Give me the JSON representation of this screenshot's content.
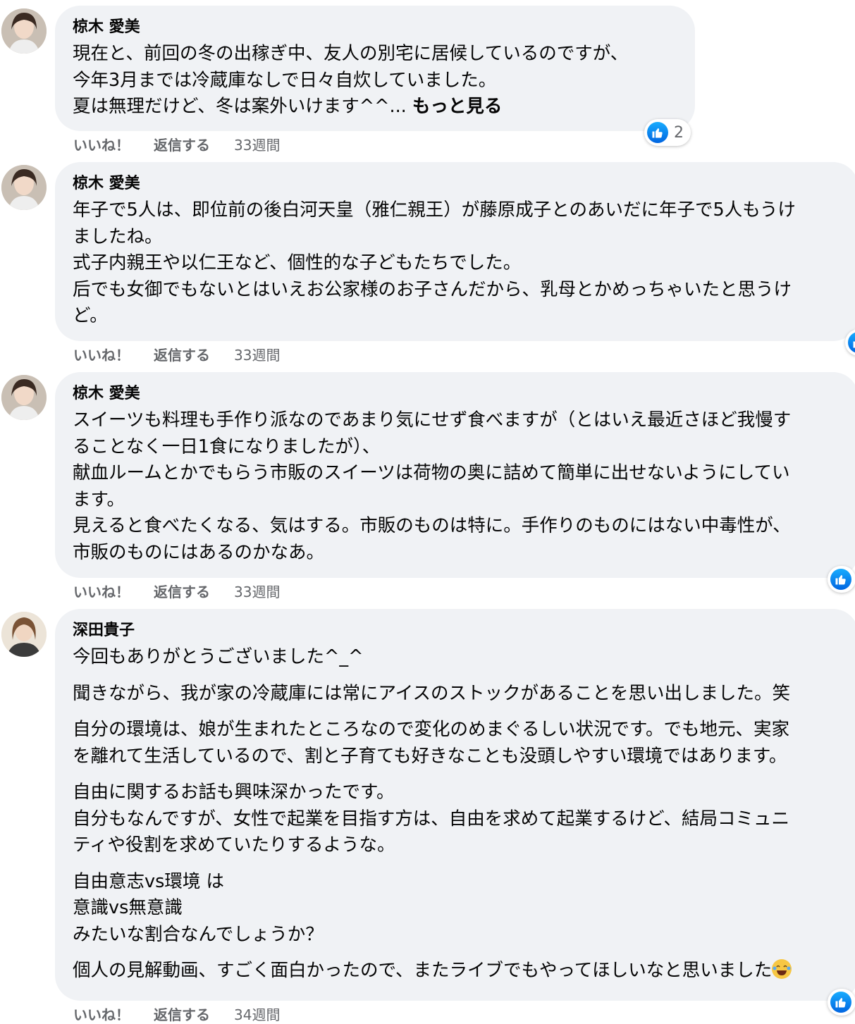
{
  "comments": [
    {
      "author": "椋木 愛美",
      "lines": [
        "現在と、前回の冬の出稼ぎ中、友人の別宅に居候しているのですが、",
        "今年3月までは冷蔵庫なしで日々自炊していました。",
        "夏は無理だけど、冬は案外いけます^^..."
      ],
      "see_more": "もっと見る",
      "like": "いいね！",
      "reply": "返信する",
      "time": "33週間",
      "reaction_count": "2",
      "reaction_icon": "like-icon"
    },
    {
      "author": "椋木 愛美",
      "lines": [
        "年子で5人は、即位前の後白河天皇（雅仁親王）が藤原成子とのあいだに年子で5人もうけ",
        "ましたね。",
        "式子内親王や以仁王など、個性的な子どもたちでした。",
        "后でも女御でもないとはいえお公家様のお子さんだから、乳母とかめっちゃいたと思うけ",
        "ど。"
      ],
      "like": "いいね！",
      "reply": "返信する",
      "time": "33週間",
      "reaction_icon": "like-icon"
    },
    {
      "author": "椋木 愛美",
      "lines": [
        "スイーツも料理も手作り派なのであまり気にせず食べますが（とはいえ最近さほど我慢す",
        "ることなく一日1食になりましたが）、",
        "献血ルームとかでもらう市販のスイーツは荷物の奥に詰めて簡単に出せないようにしてい",
        "ます。",
        "見えると食べたくなる、気はする。市販のものは特に。手作りのものにはない中毒性が、",
        "市販のものにはあるのかなあ。"
      ],
      "like": "いいね！",
      "reply": "返信する",
      "time": "33週間",
      "reaction_icon": "like-icon"
    },
    {
      "author": "深田貴子",
      "paragraphs": [
        [
          "今回もありがとうございました^_^"
        ],
        [
          "聞きながら、我が家の冷蔵庫には常にアイスのストックがあることを思い出しました。笑"
        ],
        [
          "自分の環境は、娘が生まれたところなので変化のめまぐるしい状況です。でも地元、実家",
          "を離れて生活しているので、割と子育ても好きなことも没頭しやすい環境ではあります。"
        ],
        [
          "自由に関するお話も興味深かったです。",
          "自分もなんですが、女性で起業を目指す方は、自由を求めて起業するけど、結局コミュニ",
          "ティや役割を求めていたりするような。"
        ],
        [
          "自由意志vs環境 は",
          "意識vs無意識",
          "みたいな割合なんでしょうか？"
        ],
        [
          "個人の見解動画、すごく面白かったので、またライブでもやってほしいなと思いました"
        ]
      ],
      "trailing_emoji": "laughing-emoji-icon",
      "like": "いいね！",
      "reply": "返信する",
      "time": "34週間",
      "reaction_icon": "like-icon"
    }
  ],
  "colors": {
    "bubble": "#f0f2f5",
    "meta": "#65676b",
    "like_blue": "#1877f2"
  }
}
